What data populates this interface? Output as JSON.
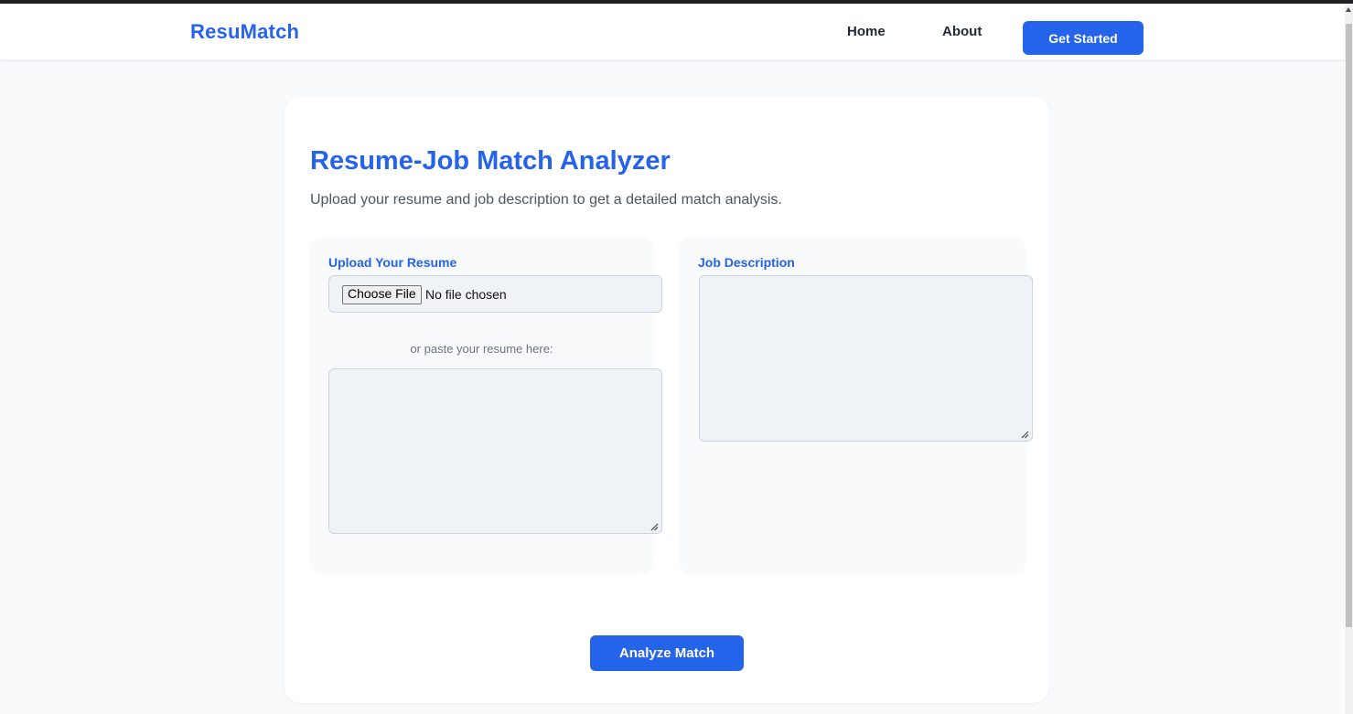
{
  "nav": {
    "brand": "ResuMatch",
    "links": [
      "Home",
      "About"
    ],
    "cta_label": "Get Started"
  },
  "main": {
    "title": "Resume-Job Match Analyzer",
    "subtitle": "Upload your resume and job description to get a detailed match analysis.",
    "resume_panel": {
      "label": "Upload Your Resume",
      "file_button": "Choose File",
      "file_status": "No file chosen",
      "paste_label": "or paste your resume here:",
      "textarea_value": ""
    },
    "job_panel": {
      "label": "Job Description",
      "textarea_value": ""
    },
    "analyze_label": "Analyze Match"
  },
  "colors": {
    "accent": "#2563eb",
    "page_bg": "#f8fafc",
    "card_bg": "#ffffff",
    "input_bg": "#eff2f6"
  }
}
